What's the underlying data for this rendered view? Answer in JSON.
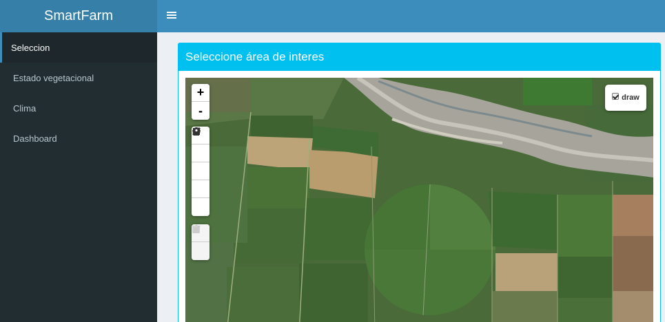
{
  "app": {
    "title": "SmartFarm"
  },
  "header": {
    "menu_icon": "hamburger-icon"
  },
  "sidebar": {
    "items": [
      {
        "label": "Seleccion",
        "active": true
      },
      {
        "label": "Estado vegetacional",
        "active": false
      },
      {
        "label": "Clima",
        "active": false
      },
      {
        "label": "Dashboard",
        "active": false
      }
    ]
  },
  "panel": {
    "title": "Seleccione área de interes"
  },
  "map": {
    "zoom_in": "+",
    "zoom_out": "-",
    "draw_tools": [
      "polyline-icon",
      "polygon-icon",
      "rectangle-icon",
      "circle-icon",
      "marker-icon"
    ],
    "edit_tools": [
      "edit-icon",
      "trash-icon"
    ],
    "layer_control": {
      "label": "draw",
      "checked": true
    }
  },
  "colors": {
    "header": "#3c8dbc",
    "logo": "#367fa9",
    "sidebar": "#222d32",
    "panel_header": "#00c0ef"
  }
}
